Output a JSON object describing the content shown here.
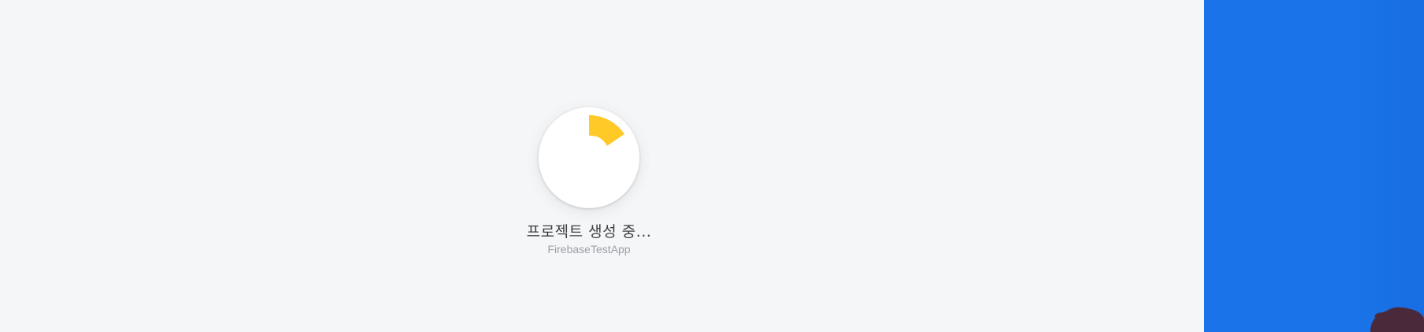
{
  "loader": {
    "title": "프로젝트 생성 중...",
    "project_name": "FirebaseTestApp",
    "spinner_icon": "progress-spinner-icon",
    "accent_color": "#ffca28"
  },
  "side_panel": {
    "background_color": "#1a73e8",
    "illustration_icon": "decorative-illustration-icon"
  }
}
